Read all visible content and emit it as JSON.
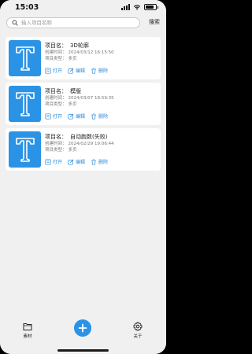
{
  "status": {
    "time": "15:03"
  },
  "search": {
    "placeholder": "输入项目名称",
    "button_label": "搜索"
  },
  "labels": {
    "name": "项目名：",
    "created": "创建时间：",
    "type": "项目类型："
  },
  "projects": [
    {
      "name": "3D轮廓",
      "created": "2024/03/12 16:15:50",
      "type": "多页",
      "actions": {
        "open": "打开",
        "edit": "编辑",
        "delete": "删除"
      }
    },
    {
      "name": "模版",
      "created": "2024/03/07 18:59:35",
      "type": "多页",
      "actions": {
        "open": "打开",
        "edit": "编辑",
        "delete": "删除"
      }
    },
    {
      "name": "自动跑数(失败)",
      "created": "2024/02/29 19:06:44",
      "type": "多页",
      "actions": {
        "open": "打开",
        "edit": "编辑",
        "delete": "删除"
      }
    }
  ],
  "bottom_nav": {
    "left_label": "素材",
    "right_label": "关于"
  },
  "colors": {
    "accent": "#2b93e6",
    "background": "#f0f0f0",
    "card": "#ffffff"
  },
  "icons": {
    "project_thumbnail": "text-T-icon",
    "open": "open-file-icon",
    "edit": "edit-icon",
    "delete": "trash-icon",
    "fab": "plus-icon",
    "left_nav": "folder-icon",
    "right_nav": "gear-icon"
  }
}
